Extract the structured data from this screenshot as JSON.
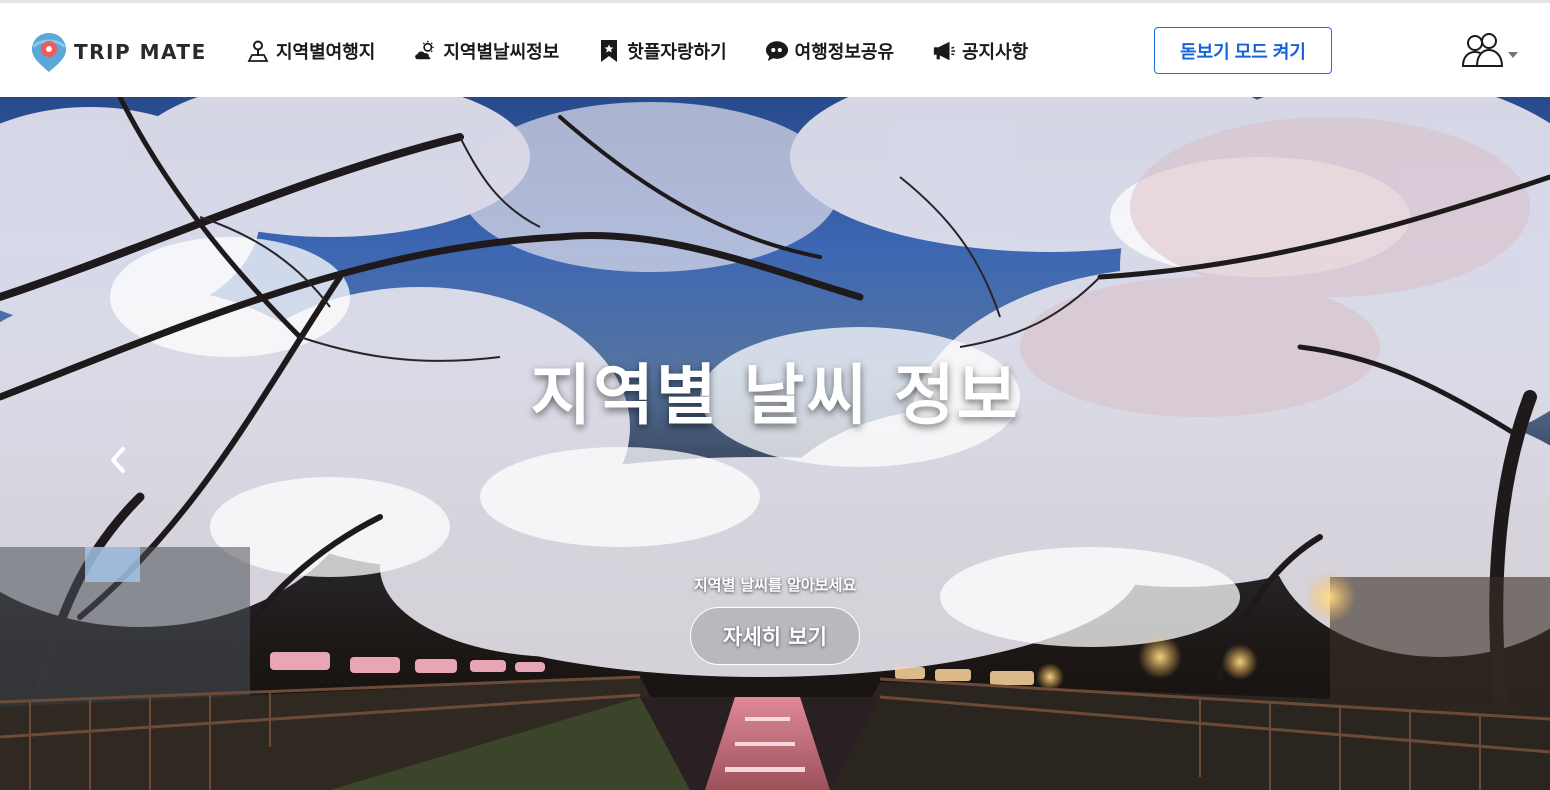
{
  "brand": {
    "name": "TRIP MATE",
    "accent_color": "#5aa7d8",
    "pin_color": "#f05a5a"
  },
  "nav": {
    "items": [
      {
        "label": "지역별여행지",
        "icon": "map-pin-person-icon"
      },
      {
        "label": "지역별날씨정보",
        "icon": "weather-sun-cloud-icon"
      },
      {
        "label": "핫플자랑하기",
        "icon": "bookmark-icon"
      },
      {
        "label": "여행정보공유",
        "icon": "chat-bubble-quote-icon"
      },
      {
        "label": "공지사항",
        "icon": "megaphone-icon"
      }
    ],
    "magnifier_button_label": "돋보기 모드 켜기",
    "magnifier_button_color": "#1e6fe0",
    "user_icon": "user-group-icon",
    "user_dropdown_icon": "caret-down-icon"
  },
  "hero": {
    "title": "지역별 날씨 정보",
    "subtitle": "지역별 날씨를 알아보세요",
    "button_label": "자세히 보기",
    "prev_icon": "chevron-left-icon",
    "background_image": "cherry-blossom-night-canal"
  }
}
